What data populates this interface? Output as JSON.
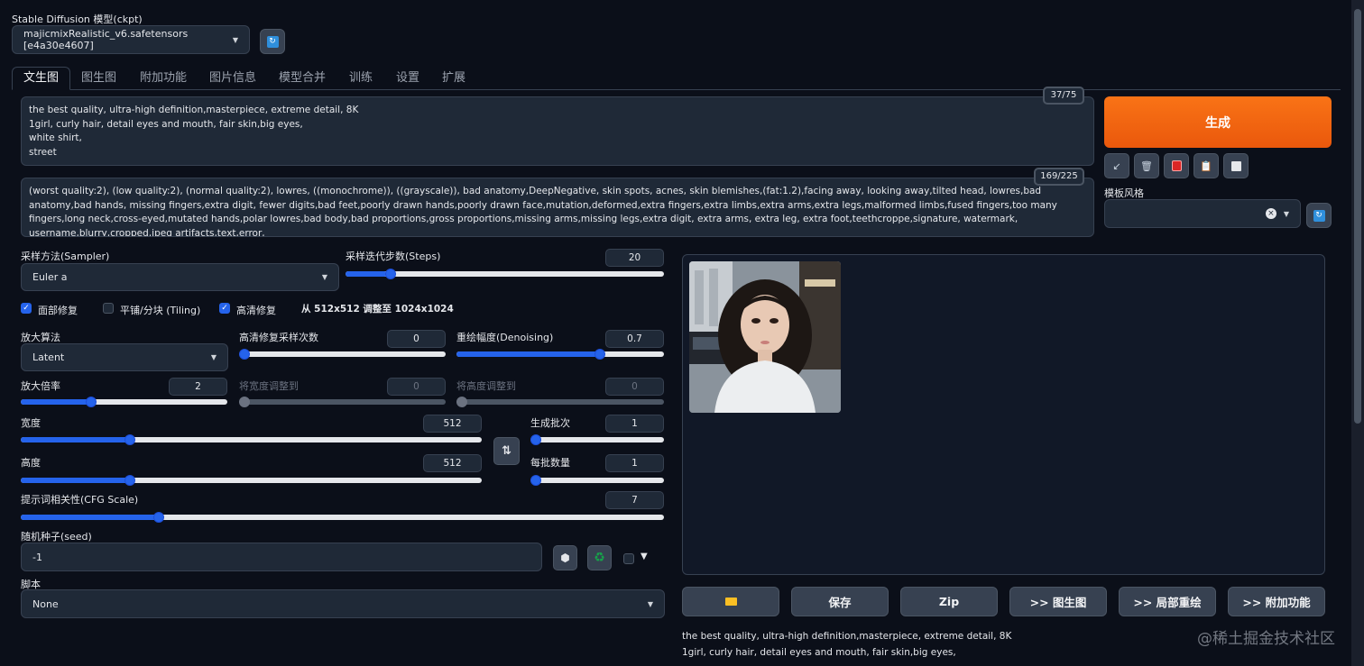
{
  "model": {
    "label": "Stable Diffusion 模型(ckpt)",
    "selected": "majicmixRealistic_v6.safetensors [e4a30e4607]"
  },
  "tabs": [
    {
      "label": "文生图",
      "active": true
    },
    {
      "label": "图生图"
    },
    {
      "label": "附加功能"
    },
    {
      "label": "图片信息"
    },
    {
      "label": "模型合并"
    },
    {
      "label": "训练"
    },
    {
      "label": "设置"
    },
    {
      "label": "扩展"
    }
  ],
  "prompt": {
    "counter": "37/75",
    "lines": [
      "the best quality, ultra-high definition,masterpiece, extreme detail, 8K",
      "1girl, curly hair, detail eyes and mouth, fair skin,big eyes,",
      "white shirt,",
      "street"
    ]
  },
  "negative_prompt": {
    "counter": "169/225",
    "text": "(worst quality:2), (low quality:2), (normal quality:2), lowres, ((monochrome)), ((grayscale)), bad anatomy,DeepNegative, skin spots, acnes, skin blemishes,(fat:1.2),facing away, looking away,tilted head, lowres,bad anatomy,bad hands, missing fingers,extra digit, fewer digits,bad feet,poorly drawn hands,poorly drawn face,mutation,deformed,extra fingers,extra limbs,extra arms,extra legs,malformed limbs,fused fingers,too many fingers,long neck,cross-eyed,mutated hands,polar lowres,bad body,bad proportions,gross proportions,missing arms,missing legs,extra digit, extra arms, extra leg, extra foot,teethcroppe,signature, watermark, username,blurry,cropped,jpeg artifacts,text,error,"
  },
  "generate": {
    "label": "生成",
    "color": "#f97316"
  },
  "style": {
    "label": "模板风格"
  },
  "sampler": {
    "label": "采样方法(Sampler)",
    "value": "Euler a"
  },
  "steps": {
    "label": "采样迭代步数(Steps)",
    "value": "20",
    "fraction": 0.13
  },
  "checks": {
    "face_restore": {
      "label": "面部修复",
      "checked": true
    },
    "tiling": {
      "label": "平铺/分块 (Tiling)",
      "checked": false
    },
    "hires": {
      "label": "高清修复",
      "checked": true
    },
    "resize_note": "从 512x512 调整至 1024x1024"
  },
  "upscaler": {
    "label": "放大算法",
    "value": "Latent"
  },
  "hires_steps": {
    "label": "高清修复采样次数",
    "value": "0",
    "fraction": 0.0
  },
  "denoise": {
    "label": "重绘幅度(Denoising)",
    "value": "0.7",
    "fraction": 0.7
  },
  "scale": {
    "label": "放大倍率",
    "value": "2",
    "fraction": 0.33
  },
  "resize_w": {
    "label": "将宽度调整到",
    "value": "0"
  },
  "resize_h": {
    "label": "将高度调整到",
    "value": "0"
  },
  "width": {
    "label": "宽度",
    "value": "512",
    "fraction": 0.23
  },
  "height": {
    "label": "高度",
    "value": "512",
    "fraction": 0.23
  },
  "batch_count": {
    "label": "生成批次",
    "value": "1",
    "fraction": 0.0
  },
  "batch_size": {
    "label": "每批数量",
    "value": "1",
    "fraction": 0.0
  },
  "cfg": {
    "label": "提示词相关性(CFG Scale)",
    "value": "7",
    "fraction": 0.21
  },
  "seed": {
    "label": "随机种子(seed)",
    "value": "-1"
  },
  "script": {
    "label": "脚本",
    "value": "None"
  },
  "output_actions": [
    {
      "label": ""
    },
    {
      "label": "保存"
    },
    {
      "label": "Zip"
    },
    {
      "label": ">> 图生图"
    },
    {
      "label": ">> 局部重绘"
    },
    {
      "label": ">> 附加功能"
    }
  ],
  "output_info": [
    "the best quality, ultra-high definition,masterpiece, extreme detail, 8K",
    "1girl, curly hair, detail eyes and mouth, fair skin,big eyes,"
  ],
  "watermark": "@稀土掘金技术社区"
}
